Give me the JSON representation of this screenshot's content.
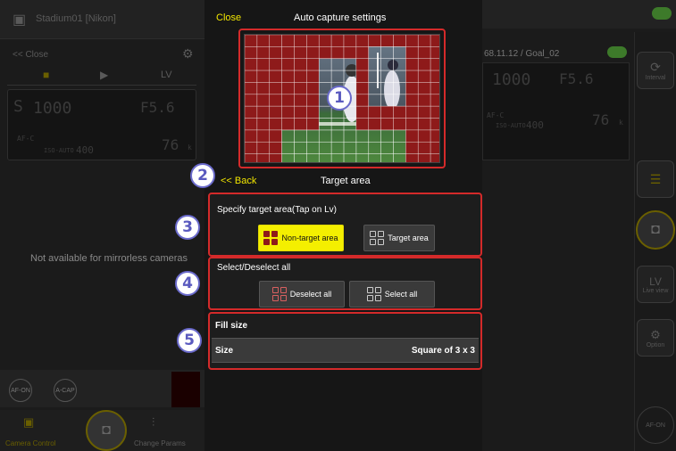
{
  "left": {
    "camera_name": "Stadium01 [Nikon]",
    "close_label": "<< Close",
    "tab_lv": "LV",
    "shutter": "1000",
    "aperture": "F5.6",
    "af_mode": "AF-C",
    "iso": "ISO-AUTO",
    "iso_value": "400",
    "shots": "76",
    "shots_unit": "k",
    "message": "Not available for mirrorless cameras",
    "af_on": "AF-ON",
    "a_cap": "A-CAP",
    "bottom_camera_control": "Camera Control",
    "bottom_change_params": "Change Params"
  },
  "header": {
    "close": "Close",
    "title": "Auto capture settings"
  },
  "subheader": {
    "back": "<< Back",
    "title": "Target area"
  },
  "callouts": [
    "1",
    "2",
    "3",
    "4",
    "5"
  ],
  "section_target": {
    "title": "Specify target area(Tap on Lv)",
    "non_target_label": "Non-target area",
    "target_label": "Target area"
  },
  "section_select": {
    "title": "Select/Deselect all",
    "deselect_label": "Deselect all",
    "select_label": "Select all"
  },
  "section_fill": {
    "title": "Fill size",
    "size_label": "Size",
    "size_value": "Square of 3 x 3"
  },
  "right": {
    "info": "68.11.12 / Goal_02",
    "shutter": "1000",
    "aperture": "F5.6",
    "af_mode": "AF-C",
    "iso": "ISO-AUTO",
    "iso_value": "400",
    "shots": "76",
    "shots_unit": "k",
    "interval_label": "Interval",
    "lv_label": "LV",
    "live_view_label": "Live view",
    "option_label": "Option",
    "af_on": "AF-ON"
  },
  "colors": {
    "accent_yellow": "#f4ef00",
    "callout_red": "#d42a2a",
    "non_target_cell": "#8e1a1a"
  }
}
